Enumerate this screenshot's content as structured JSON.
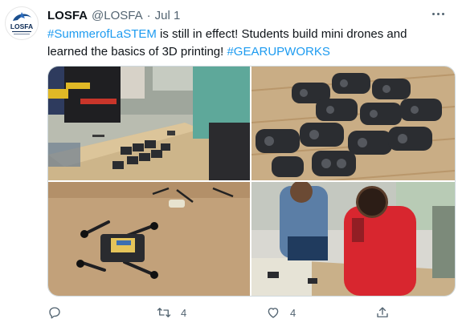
{
  "tweet": {
    "display_name": "LOSFA",
    "handle": "@LOSFA",
    "separator": "·",
    "date": "Jul 1",
    "avatar_text": "LOSFA",
    "text_parts": [
      {
        "text": "#SummerofLaSTEM",
        "type": "hashtag"
      },
      {
        "text": " is still in effect! Students build mini drones and learned the basics of 3D printing! ",
        "type": "plain"
      },
      {
        "text": "#GEARUPWORKS",
        "type": "hashtag"
      }
    ]
  },
  "actions": {
    "reply_count": "",
    "retweet_count": "4",
    "like_count": "4"
  },
  "colors": {
    "link": "#1d9bf0",
    "secondary": "#536471",
    "border": "#cfd9de"
  },
  "icons": [
    "reply-icon",
    "retweet-icon",
    "like-icon",
    "share-icon",
    "more-options-icon"
  ]
}
